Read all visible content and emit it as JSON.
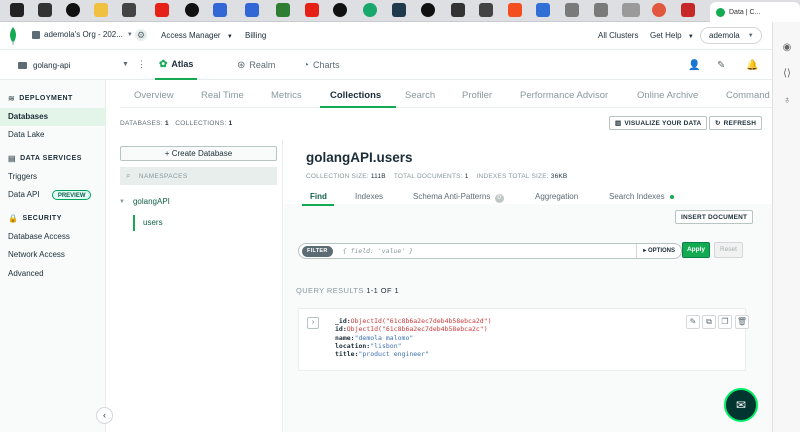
{
  "browser": {
    "active_tab_title": "Data | C..."
  },
  "topnav": {
    "org_name": "ademola's Org - 202...",
    "access_manager": "Access Manager",
    "billing": "Billing",
    "all_clusters": "All Clusters",
    "get_help": "Get Help",
    "user": "ademola"
  },
  "project": {
    "name": "golang-api",
    "tabs": [
      "Atlas",
      "Realm",
      "Charts"
    ]
  },
  "sidebar": {
    "deployment": "DEPLOYMENT",
    "databases": "Databases",
    "data_lake": "Data Lake",
    "data_services": "DATA SERVICES",
    "triggers": "Triggers",
    "data_api": "Data API",
    "preview": "PREVIEW",
    "security": "SECURITY",
    "database_access": "Database Access",
    "network_access": "Network Access",
    "advanced": "Advanced"
  },
  "subtabs": [
    "Overview",
    "Real Time",
    "Metrics",
    "Collections",
    "Search",
    "Profiler",
    "Performance Advisor",
    "Online Archive",
    "Command"
  ],
  "counts": {
    "databases_label": "DATABASES:",
    "databases": "1",
    "collections_label": "COLLECTIONS:",
    "collections": "1"
  },
  "actions": {
    "visualize": "VISUALIZE YOUR DATA",
    "refresh": "REFRESH"
  },
  "namespaces": {
    "create_db": "Create Database",
    "search_placeholder": "NAMESPACES",
    "database": "golangAPI",
    "collection": "users"
  },
  "collection": {
    "title": "golangAPI.users",
    "size_label": "COLLECTION SIZE:",
    "size": "111B",
    "docs_label": "TOTAL DOCUMENTS:",
    "docs": "1",
    "index_label": "INDEXES TOTAL SIZE:",
    "index_size": "36KB",
    "tabs": [
      "Find",
      "Indexes",
      "Schema Anti-Patterns",
      "Aggregation",
      "Search Indexes"
    ],
    "schema_badge": "0",
    "insert_document": "INSERT DOCUMENT"
  },
  "filter": {
    "label": "FILTER",
    "placeholder": "{ field: 'value' }",
    "options": "OPTIONS",
    "apply": "Apply",
    "reset": "Reset"
  },
  "results": {
    "label": "QUERY RESULTS",
    "range": "1-1 OF 1"
  },
  "document": {
    "id_key": "_id:",
    "id_val": "ObjectId(\"61c8b6a2ec7deb4b58ebca2d\")",
    "id2_key": "id:",
    "id2_val": "ObjectId(\"61c8b6a2ec7deb4b58ebca2c\")",
    "name_key": "name:",
    "name_val": "\"demola malomo\"",
    "location_key": "location:",
    "location_val": "\"lisbon\"",
    "title_key": "title:",
    "title_val": "\"product engineer\""
  },
  "colors": {
    "accent": "#13aa52",
    "dark": "#1c2d38",
    "objectid": "#c93a3a",
    "string": "#3a6fb1"
  }
}
